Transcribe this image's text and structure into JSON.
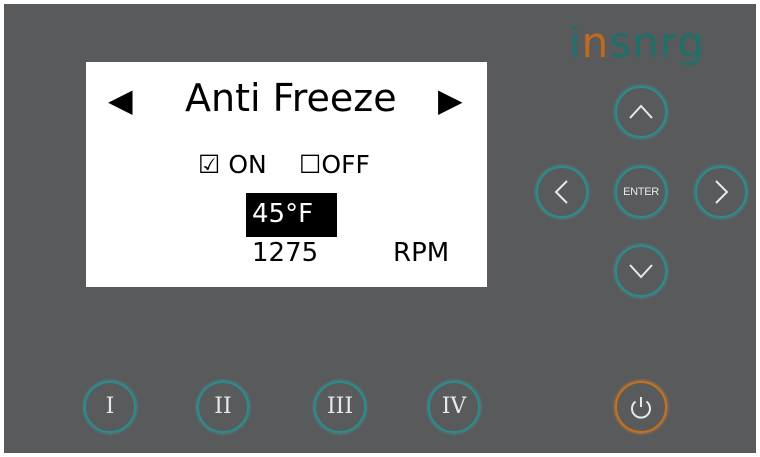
{
  "brand": {
    "logo_part1": "i",
    "logo_part2": "n",
    "logo_part3": "snrg",
    "teal": "#1f6f6a",
    "orange": "#c06a1f"
  },
  "screen": {
    "left_arrow": "◀",
    "right_arrow": "▶",
    "title": "Anti Freeze",
    "on_option": "☑ ON",
    "off_option": "☐OFF",
    "temperature": "45°F",
    "speed_value": "1275",
    "speed_unit": "RPM"
  },
  "nav": {
    "up_icon": "chevron-up-icon",
    "down_icon": "chevron-down-icon",
    "left_icon": "chevron-left-icon",
    "right_icon": "chevron-right-icon",
    "enter_label": "ENTER"
  },
  "speed_buttons": [
    "I",
    "II",
    "III",
    "IV"
  ],
  "power": {
    "icon": "power-icon"
  },
  "colors": {
    "panel": "#595a5c",
    "ring": "#2b8c8c",
    "power_ring": "#c7701f"
  }
}
